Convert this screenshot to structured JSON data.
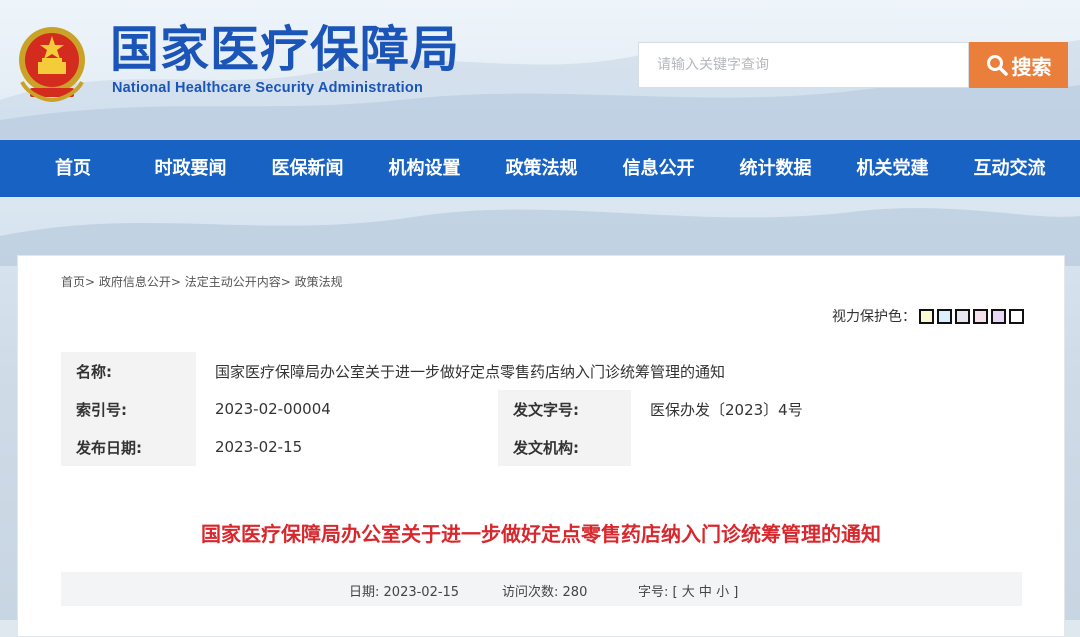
{
  "header": {
    "logo_cn": "国家医疗保障局",
    "logo_en": "National Healthcare Security Administration",
    "search_placeholder": "请输入关键字查询",
    "search_label": "搜索"
  },
  "nav": [
    "首页",
    "时政要闻",
    "医保新闻",
    "机构设置",
    "政策法规",
    "信息公开",
    "统计数据",
    "机关党建",
    "互动交流"
  ],
  "breadcrumb": [
    "首页>",
    "政府信息公开>",
    "法定主动公开内容>",
    "政策法规"
  ],
  "eye_care": {
    "label": "视力保护色：",
    "colors": [
      "#fafad2",
      "#daf0ff",
      "#e6e6f0",
      "#f5e1eb",
      "#e6d8f5",
      "#ffffff"
    ]
  },
  "meta": {
    "name_label": "名称:",
    "name_value": "国家医疗保障局办公室关于进一步做好定点零售药店纳入门诊统筹管理的通知",
    "index_label": "索引号:",
    "index_value": "2023-02-00004",
    "docno_label": "发文字号:",
    "docno_value": "医保办发〔2023〕4号",
    "date_label": "发布日期:",
    "date_value": "2023-02-15",
    "org_label": "发文机构:",
    "org_value": ""
  },
  "article": {
    "title": "国家医疗保障局办公室关于进一步做好定点零售药店纳入门诊统筹管理的通知",
    "date_label": "日期:",
    "date_value": "2023-02-15",
    "visits_label": "访问次数:",
    "visits_value": "280",
    "size_label": "字号:",
    "size_open": "[",
    "size_large": "大",
    "size_medium": "中",
    "size_small": "小",
    "size_close": "]"
  }
}
